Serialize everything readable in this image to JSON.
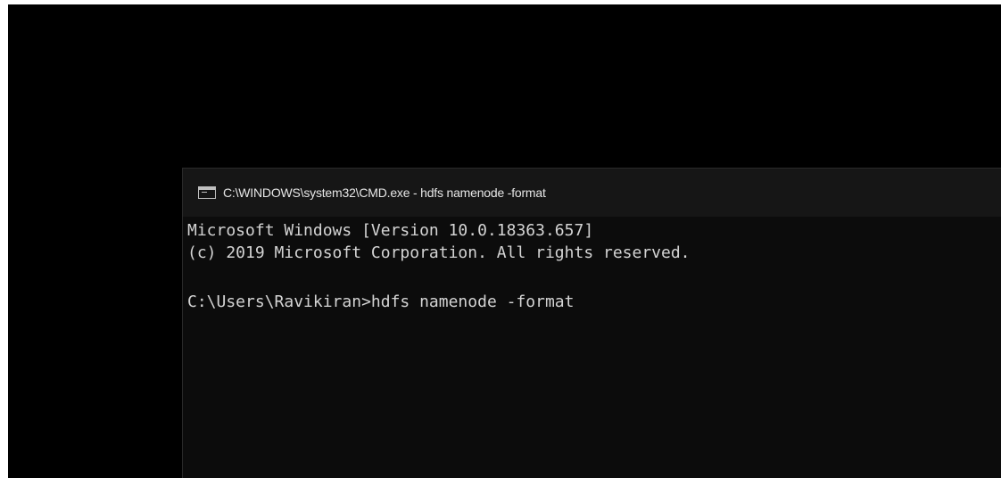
{
  "window": {
    "title": "C:\\WINDOWS\\system32\\CMD.exe - hdfs  namenode -format",
    "icon": "cmd-icon"
  },
  "console": {
    "lines": [
      "Microsoft Windows [Version 10.0.18363.657]",
      "(c) 2019 Microsoft Corporation. All rights reserved.",
      "",
      "C:\\Users\\Ravikiran>hdfs namenode -format"
    ]
  },
  "colors": {
    "background": "#000000",
    "console_background": "#0c0c0c",
    "title_bar": "#161616",
    "text": "#d4d4d4"
  }
}
